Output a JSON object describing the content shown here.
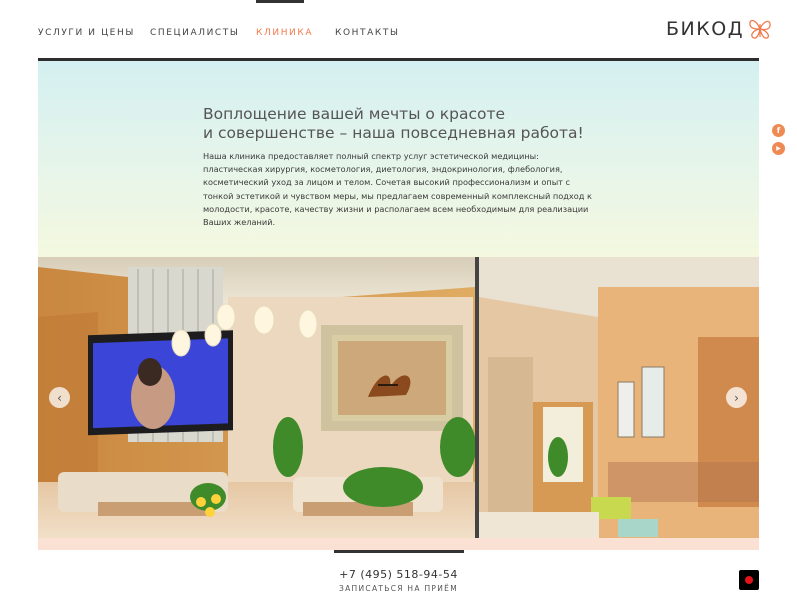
{
  "nav": {
    "items": [
      {
        "label": "УСЛУГИ И ЦЕНЫ",
        "active": false
      },
      {
        "label": "СПЕЦИАЛИСТЫ",
        "active": false
      },
      {
        "label": "КЛИНИКА",
        "active": true
      },
      {
        "label": "КОНТАКТЫ",
        "active": false
      }
    ]
  },
  "logo": {
    "text": "БИКОД",
    "icon": "butterfly-icon"
  },
  "hero": {
    "title_line1": "Воплощение вашей мечты о красоте",
    "title_line2": "и совершенстве – наша повседневная работа!",
    "text": "Наша клиника предоставляет полный спектр услуг эстетической медицины: пластическая хирургия, косметология, диетология, эндокринология, флебология, косметический уход за лицом и телом. Сочетая высокий профессионализм и опыт с тонкой эстетикой и чувством меры, мы предлагаем современный комплексный подход к молодости, красоте, качеству жизни и располагаем всем необходимым для реализации Ваших желаний."
  },
  "slider": {
    "prev_icon": "chevron-left-icon",
    "next_icon": "chevron-right-icon",
    "prev_glyph": "‹",
    "next_glyph": "›"
  },
  "footer": {
    "phone": "+7 (495) 518-94-54",
    "book_label": "ЗАПИСАТЬСЯ НА ПРИЁМ"
  },
  "social": [
    {
      "icon": "facebook-icon",
      "glyph": "f"
    },
    {
      "icon": "youtube-icon",
      "glyph": "▶"
    }
  ],
  "colors": {
    "accent": "#f07a4e",
    "social": "#f08a55",
    "record": "#e0141a"
  }
}
